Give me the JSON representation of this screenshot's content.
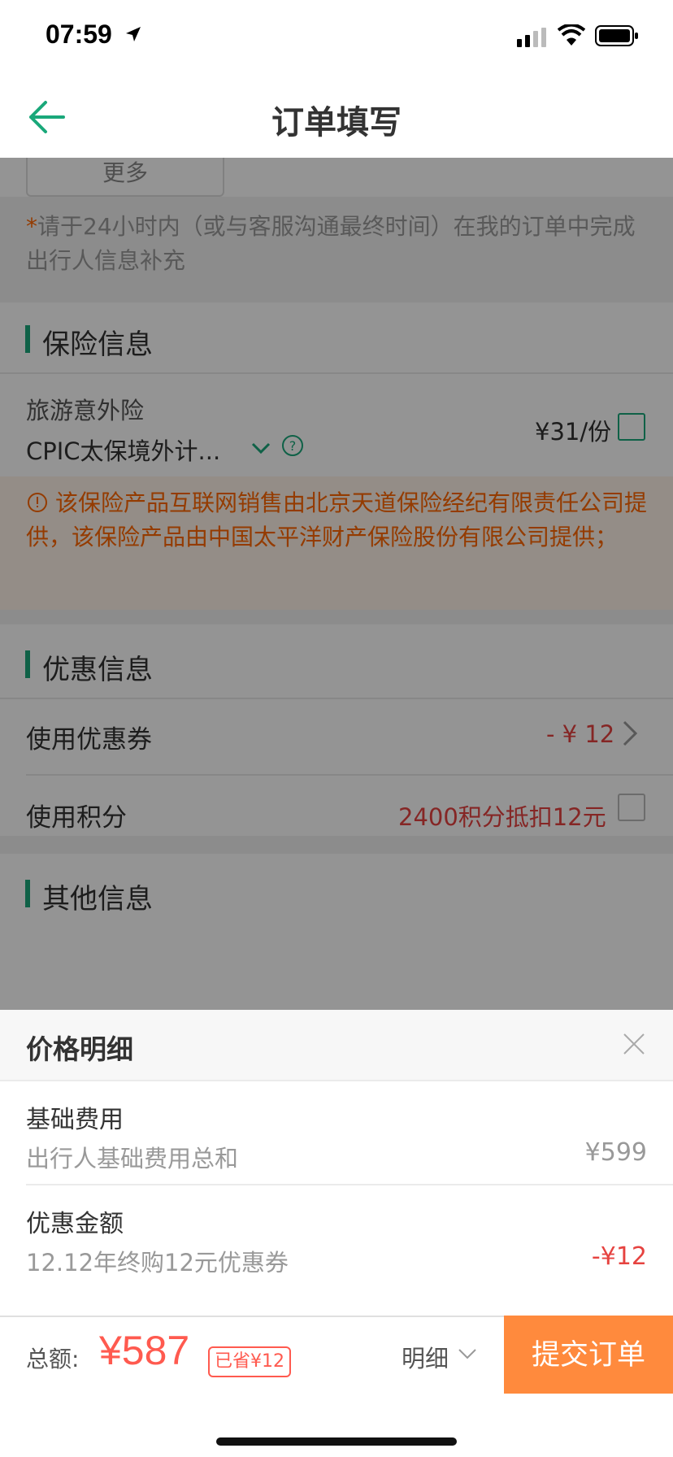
{
  "status_bar": {
    "time": "07:59"
  },
  "nav": {
    "title": "订单填写",
    "back_icon": "arrow-left-icon"
  },
  "traveler": {
    "more_label": "更多",
    "notice_star": "*",
    "notice": "请于24小时内（或与客服沟通最终时间）在我的订单中完成出行人信息补充"
  },
  "insurance": {
    "section_title": "保险信息",
    "type_label": "旅游意外险",
    "product_name": "CPIC太保境外计...",
    "price": "¥31/份",
    "warning": "该保险产品互联网销售由北京天道保险经纪有限责任公司提供，该保险产品由中国太平洋财产保险股份有限公司提供；"
  },
  "discount": {
    "section_title": "优惠信息",
    "coupon_label": "使用优惠券",
    "coupon_value": "- ¥ 12",
    "points_label": "使用积分",
    "points_value": "2400积分抵扣12元"
  },
  "other": {
    "section_title": "其他信息"
  },
  "price_detail": {
    "title": "价格明细",
    "items": [
      {
        "title": "基础费用",
        "desc": "出行人基础费用总和",
        "amount": "¥599"
      },
      {
        "title": "优惠金额",
        "desc": "12.12年终购12元优惠券",
        "amount": "-¥12"
      }
    ]
  },
  "bottom_bar": {
    "total_label": "总额:",
    "total_amount": "¥587",
    "saved_badge": "已省¥12",
    "detail_label": "明细",
    "submit_label": "提交订单"
  },
  "colors": {
    "accent_green": "#1aa87a",
    "price_red": "#ff5a4f",
    "submit_orange": "#ff8a3d",
    "warning_orange": "#ff6600"
  }
}
